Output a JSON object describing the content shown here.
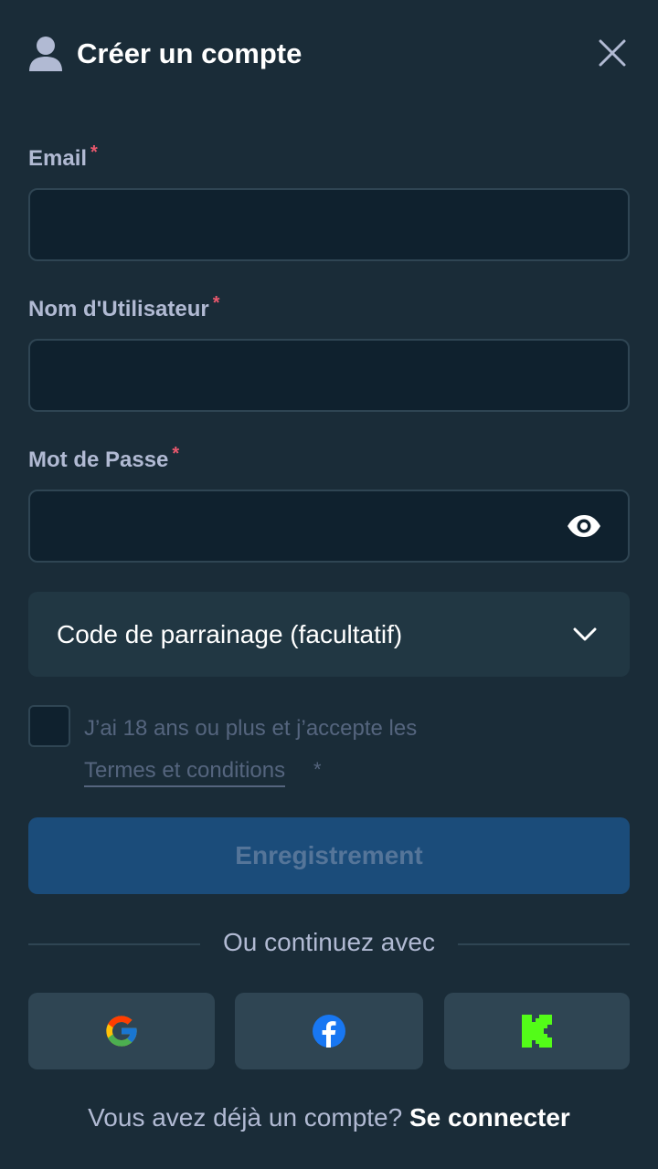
{
  "header": {
    "title": "Créer un compte",
    "icon": "user-icon",
    "close_icon": "close-icon"
  },
  "form": {
    "email": {
      "label": "Email",
      "required_mark": "*",
      "value": "",
      "placeholder": ""
    },
    "username": {
      "label": "Nom d'Utilisateur",
      "required_mark": "*",
      "value": "",
      "placeholder": ""
    },
    "password": {
      "label": "Mot de Passe",
      "required_mark": "*",
      "value": "",
      "placeholder": "",
      "toggle_icon": "eye-icon"
    },
    "referral": {
      "label": "Code de parrainage (facultatif)",
      "icon": "chevron-down-icon"
    },
    "terms": {
      "text": "J’ai 18 ans ou plus et j’accepte les",
      "link": "Termes et conditions",
      "required_mark": "*",
      "checked": false
    },
    "submit_label": "Enregistrement"
  },
  "social": {
    "divider_text": "Ou continuez avec",
    "providers": [
      {
        "name": "google",
        "icon": "google-icon"
      },
      {
        "name": "facebook",
        "icon": "facebook-icon"
      },
      {
        "name": "kick",
        "icon": "kick-icon"
      }
    ]
  },
  "footer": {
    "question": "Vous avez déjà un compte?",
    "login_label": "Se connecter"
  },
  "colors": {
    "background": "#1a2c38",
    "input_bg": "#0f212e",
    "input_border": "#2f4553",
    "label": "#b1bad3",
    "required": "#e9586d",
    "button_primary": "#1b4c7a",
    "button_primary_text": "#557599",
    "social_bg": "#2f4553",
    "kick_green": "#53fc18",
    "facebook_blue": "#1877f2"
  }
}
